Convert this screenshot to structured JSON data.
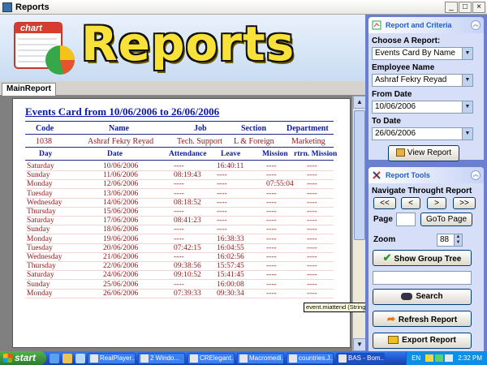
{
  "window": {
    "title": "Reports"
  },
  "banner": {
    "word": "Reports",
    "logo_label": "chart"
  },
  "tabs": [
    {
      "label": "MainReport"
    }
  ],
  "report": {
    "title": "Events Card from 10/06/2006 to 26/06/2006",
    "emp_headers": [
      "Code",
      "Name",
      "Job",
      "Section",
      "Department"
    ],
    "employee": {
      "code": "1038",
      "name": "Ashraf Fekry Reyad",
      "job": "Tech. Support",
      "section": "L & Foreign",
      "department": "Marketing"
    },
    "columns": [
      "Day",
      "Date",
      "Attendance",
      "Leave",
      "Mission",
      "rtrn. Mission"
    ],
    "rows": [
      {
        "day": "Saturday",
        "date": "10/06/2006",
        "attendance": "----",
        "leave": "16:40:11",
        "mission": "----",
        "return": "----"
      },
      {
        "day": "Sunday",
        "date": "11/06/2006",
        "attendance": "08:19:43",
        "leave": "----",
        "mission": "----",
        "return": "----"
      },
      {
        "day": "Monday",
        "date": "12/06/2006",
        "attendance": "----",
        "leave": "----",
        "mission": "07:55:04",
        "return": "----"
      },
      {
        "day": "Tuesday",
        "date": "13/06/2006",
        "attendance": "----",
        "leave": "----",
        "mission": "----",
        "return": "----"
      },
      {
        "day": "Wednesday",
        "date": "14/06/2006",
        "attendance": "08:18:52",
        "leave": "----",
        "mission": "----",
        "return": "----"
      },
      {
        "day": "Thursday",
        "date": "15/06/2006",
        "attendance": "----",
        "leave": "----",
        "mission": "----",
        "return": "----"
      },
      {
        "day": "Saturday",
        "date": "17/06/2006",
        "attendance": "08:41:23",
        "leave": "----",
        "mission": "----",
        "return": "----"
      },
      {
        "day": "Sunday",
        "date": "18/06/2006",
        "attendance": "----",
        "leave": "----",
        "mission": "----",
        "return": "----"
      },
      {
        "day": "Monday",
        "date": "19/06/2006",
        "attendance": "----",
        "leave": "16:38:33",
        "mission": "----",
        "return": "----"
      },
      {
        "day": "Tuesday",
        "date": "20/06/2006",
        "attendance": "07:42:15",
        "leave": "16:04:55",
        "mission": "----",
        "return": "----"
      },
      {
        "day": "Wednesday",
        "date": "21/06/2006",
        "attendance": "----",
        "leave": "16:02:56",
        "mission": "----",
        "return": "----"
      },
      {
        "day": "Thursday",
        "date": "22/06/2006",
        "attendance": "09:38:56",
        "leave": "15:57:45",
        "mission": "----",
        "return": "----"
      },
      {
        "day": "Saturday",
        "date": "24/06/2006",
        "attendance": "09:10:52",
        "leave": "15:41:45",
        "mission": "----",
        "return": "----"
      },
      {
        "day": "Sunday",
        "date": "25/06/2006",
        "attendance": "----",
        "leave": "16:00:08",
        "mission": "----",
        "return": "----"
      },
      {
        "day": "Monday",
        "date": "26/06/2006",
        "attendance": "07:39:33",
        "leave": "09:30:34",
        "mission": "----",
        "return": "----"
      }
    ],
    "tooltip": "event.miattend (String)"
  },
  "criteria": {
    "header": "Report and Criteria",
    "choose_label": "Choose A Report:",
    "choose_value": "Events Card By Name",
    "employee_label": "Employee Name",
    "employee_value": "Ashraf Fekry Reyad",
    "from_label": "From Date",
    "from_value": "10/06/2006",
    "to_label": "To Date",
    "to_value": "26/06/2006",
    "view_button": "View Report"
  },
  "tools": {
    "header": "Report Tools",
    "navigate_label": "Navigate Throught Report",
    "nav_buttons": [
      "<<",
      "<",
      ">",
      ">>"
    ],
    "page_label": "Page",
    "page_value": "",
    "goto_button": "GoTo Page",
    "zoom_label": "Zoom",
    "zoom_value": "88",
    "group_tree_button": "Show Group Tree",
    "search_value": "",
    "search_button": "Search",
    "refresh_button": "Refresh Report",
    "export_button": "Export Report"
  },
  "taskbar": {
    "start_label": "start",
    "tasks": [
      "RealPlayer...",
      "2 Windo...",
      "CRElegant...",
      "Macromedi...",
      "countries.J...",
      "BAS - Bom..."
    ],
    "language": "EN",
    "clock": "2:32 PM"
  },
  "colors": {
    "report_blue": "#0a1aa8",
    "report_red": "#8b1a1a",
    "panel_blue": "#6b7fd0",
    "banner_yellow": "#f8e23a"
  }
}
